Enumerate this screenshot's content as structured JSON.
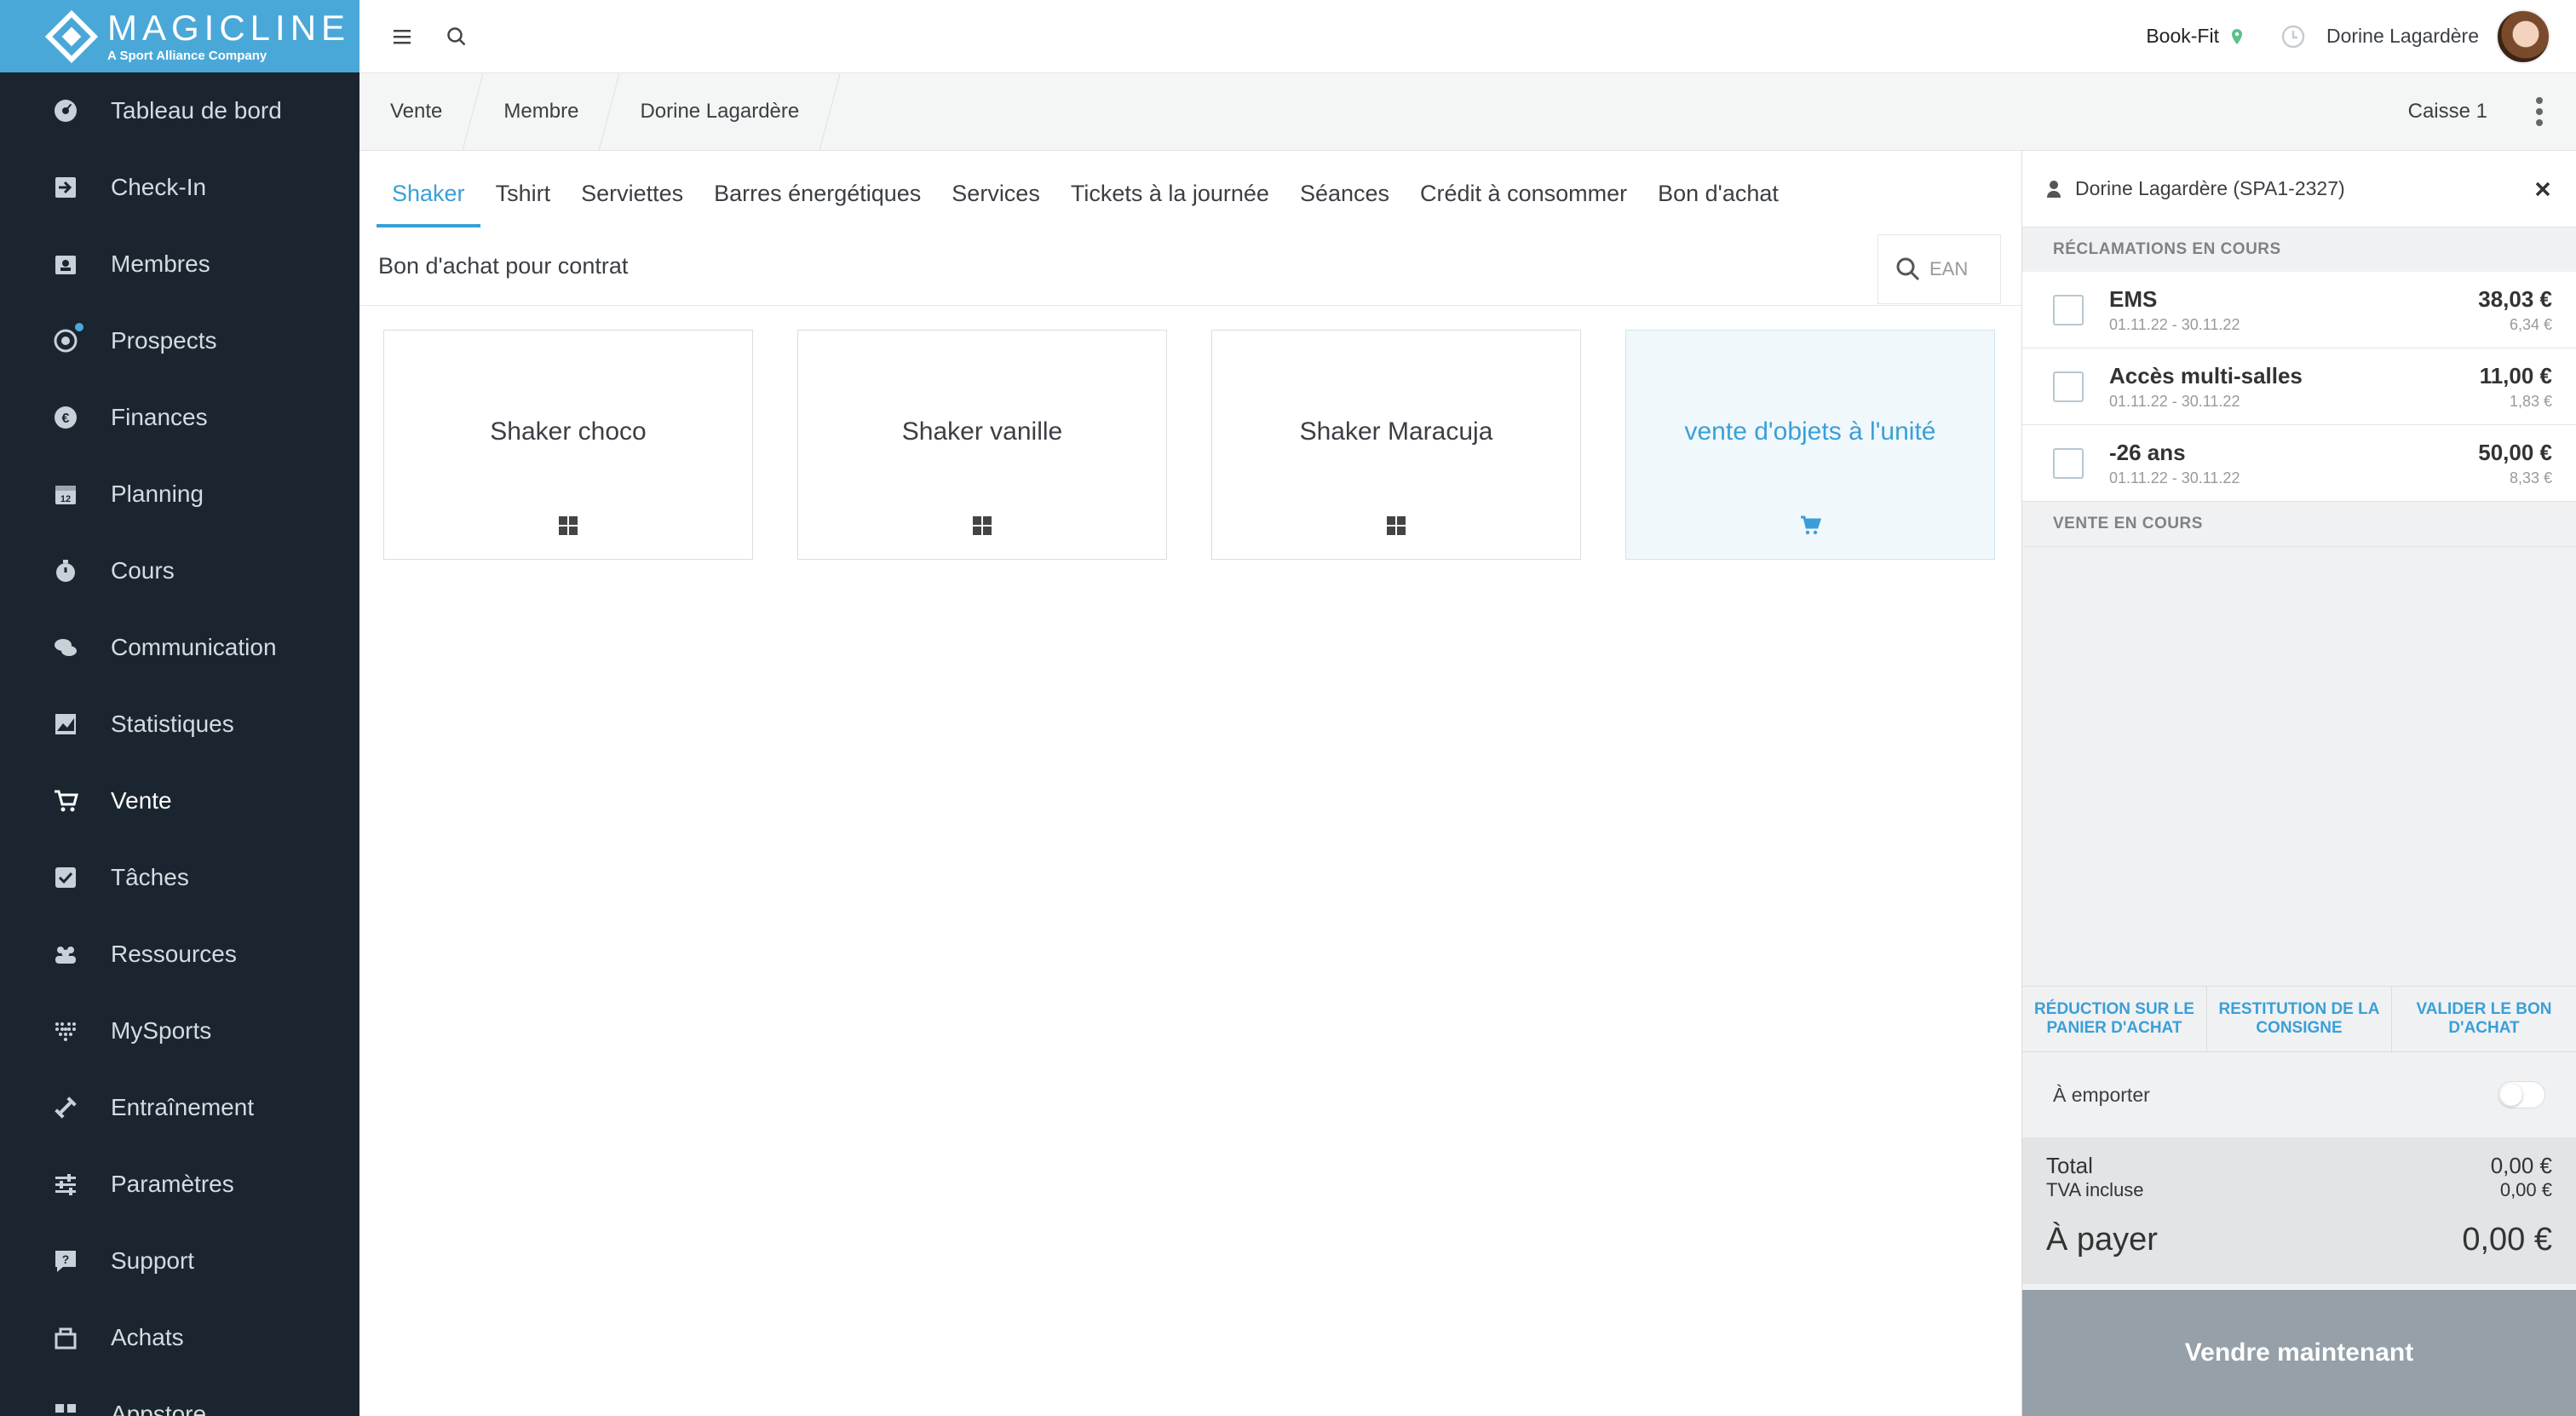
{
  "brand": {
    "name": "MAGICLINE",
    "tagline": "A Sport Alliance Company"
  },
  "sidebar": {
    "items": [
      {
        "label": "Tableau de bord",
        "icon": "dashboard-icon"
      },
      {
        "label": "Check-In",
        "icon": "check-in-icon"
      },
      {
        "label": "Membres",
        "icon": "members-icon"
      },
      {
        "label": "Prospects",
        "icon": "prospects-icon"
      },
      {
        "label": "Finances",
        "icon": "euro-icon"
      },
      {
        "label": "Planning",
        "icon": "calendar-icon"
      },
      {
        "label": "Cours",
        "icon": "stopwatch-icon"
      },
      {
        "label": "Communication",
        "icon": "chat-icon"
      },
      {
        "label": "Statistiques",
        "icon": "chart-icon"
      },
      {
        "label": "Vente",
        "icon": "cart-icon"
      },
      {
        "label": "Tâches",
        "icon": "task-icon"
      },
      {
        "label": "Ressources",
        "icon": "resources-icon"
      },
      {
        "label": "MySports",
        "icon": "mysports-icon"
      },
      {
        "label": "Entraînement",
        "icon": "dumbbell-icon"
      },
      {
        "label": "Paramètres",
        "icon": "sliders-icon"
      },
      {
        "label": "Support",
        "icon": "support-icon"
      },
      {
        "label": "Achats",
        "icon": "purchases-icon"
      },
      {
        "label": "Appstore",
        "icon": "appstore-icon"
      }
    ],
    "active": "Vente"
  },
  "topbar": {
    "studio": "Book-Fit",
    "user": "Dorine Lagardère"
  },
  "breadcrumb": {
    "items": [
      "Vente",
      "Membre",
      "Dorine Lagardère"
    ],
    "register": "Caisse 1"
  },
  "tabs": [
    "Shaker",
    "Tshirt",
    "Serviettes",
    "Barres énergétiques",
    "Services",
    "Tickets à la journée",
    "Séances",
    "Crédit à consommer",
    "Bon d'achat"
  ],
  "subbar": {
    "label": "Bon d'achat pour contrat",
    "ean_placeholder": "EAN"
  },
  "products": [
    {
      "name": "Shaker choco",
      "icon": "grid-icon"
    },
    {
      "name": "Shaker vanille",
      "icon": "grid-icon"
    },
    {
      "name": "Shaker Maracuja",
      "icon": "grid-icon"
    },
    {
      "name": "vente d'objets à l'unité",
      "icon": "cart-icon"
    }
  ],
  "panel": {
    "customer": "Dorine Lagardère (SPA1-2327)",
    "claims_label": "Réclamations en cours",
    "claims": [
      {
        "title": "EMS",
        "dates": "01.11.22 - 30.11.22",
        "price": "38,03 €",
        "tax": "6,34 €"
      },
      {
        "title": "Accès multi-salles",
        "dates": "01.11.22 - 30.11.22",
        "price": "11,00 €",
        "tax": "1,83 €"
      },
      {
        "title": "-26 ans",
        "dates": "01.11.22 - 30.11.22",
        "price": "50,00 €",
        "tax": "8,33 €"
      }
    ],
    "sale_label": "Vente en cours",
    "actions": [
      "Réduction sur le panier d'achat",
      "Restitution de la consigne",
      "Valider le bon d'achat"
    ],
    "takeaway": "À emporter",
    "total_label": "Total",
    "total": "0,00 €",
    "vat_label": "TVA incluse",
    "vat": "0,00 €",
    "pay_label": "À payer",
    "pay": "0,00 €",
    "sell_button": "Vendre maintenant"
  },
  "colors": {
    "accent": "#3a9fd8",
    "sidebar": "#1a2530",
    "logo_bg": "#4aa8d8"
  }
}
